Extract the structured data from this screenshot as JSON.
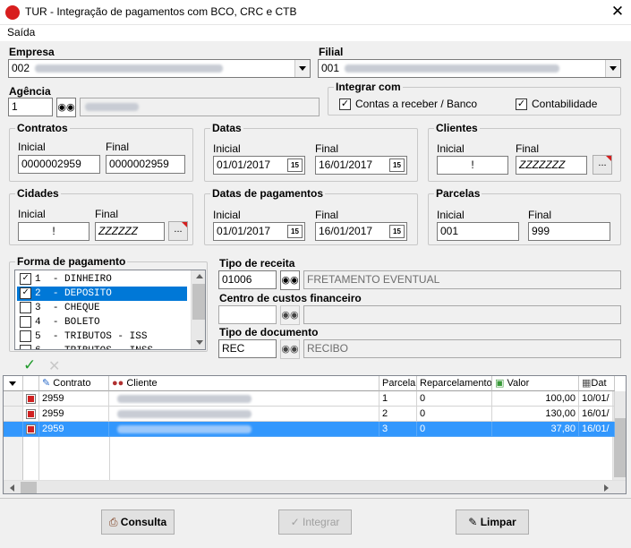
{
  "window": {
    "title": "TUR - Integração de pagamentos com BCO, CRC e CTB",
    "close_glyph": "✕"
  },
  "menu": {
    "saida": "Saída"
  },
  "empresa": {
    "label": "Empresa",
    "code": "002"
  },
  "filial": {
    "label": "Filial",
    "code": "001"
  },
  "agencia": {
    "label": "Agência",
    "value": "1"
  },
  "integrar": {
    "label": "Integrar com",
    "contas_label": "Contas a receber / Banco",
    "contas_checked": true,
    "contab_label": "Contabilidade",
    "contab_checked": true
  },
  "contratos": {
    "label": "Contratos",
    "inicial_label": "Inicial",
    "final_label": "Final",
    "inicial": "0000002959",
    "final": "0000002959"
  },
  "datas": {
    "label": "Datas",
    "inicial_label": "Inicial",
    "final_label": "Final",
    "inicial": "01/01/2017",
    "final": "16/01/2017"
  },
  "clientes": {
    "label": "Clientes",
    "inicial_label": "Inicial",
    "final_label": "Final",
    "inicial": "!",
    "final": "ZZZZZZZ"
  },
  "cidades": {
    "label": "Cidades",
    "inicial_label": "Inicial",
    "final_label": "Final",
    "inicial": "!",
    "final": "ZZZZZZ"
  },
  "datas_pag": {
    "label": "Datas de pagamentos",
    "inicial_label": "Inicial",
    "final_label": "Final",
    "inicial": "01/01/2017",
    "final": "16/01/2017"
  },
  "parcelas": {
    "label": "Parcelas",
    "inicial_label": "Inicial",
    "final_label": "Final",
    "inicial": "001",
    "final": "999"
  },
  "forma": {
    "label": "Forma de pagamento",
    "items": [
      {
        "code": "1",
        "text": "- DINHEIRO",
        "checked": true,
        "selected": false
      },
      {
        "code": "2",
        "text": "- DEPOSITO",
        "checked": true,
        "selected": true
      },
      {
        "code": "3",
        "text": "- CHEQUE",
        "checked": false,
        "selected": false
      },
      {
        "code": "4",
        "text": "- BOLETO",
        "checked": false,
        "selected": false
      },
      {
        "code": "5",
        "text": "- TRIBUTOS - ISS",
        "checked": false,
        "selected": false
      },
      {
        "code": "6",
        "text": "- TRIBUTOS - INSS",
        "checked": false,
        "selected": false
      }
    ]
  },
  "tipo_receita": {
    "label": "Tipo de receita",
    "code": "01006",
    "desc": "FRETAMENTO EVENTUAL"
  },
  "centro_custos": {
    "label": "Centro de custos financeiro",
    "code": "",
    "desc": ""
  },
  "tipo_doc": {
    "label": "Tipo de documento",
    "code": "REC",
    "desc": "RECIBO"
  },
  "cal_glyph": "15",
  "dots_glyph": "...",
  "check_glyph": "✓",
  "grid": {
    "headers": [
      "Contrato",
      "Cliente",
      "Parcela",
      "Reparcelamento",
      "Valor",
      "Dat"
    ],
    "rows": [
      {
        "contrato": "2959",
        "parcela": "1",
        "reparc": "0",
        "valor": "100,00",
        "data": "10/01/",
        "selected": false
      },
      {
        "contrato": "2959",
        "parcela": "2",
        "reparc": "0",
        "valor": "130,00",
        "data": "16/01/",
        "selected": false
      },
      {
        "contrato": "2959",
        "parcela": "3",
        "reparc": "0",
        "valor": "37,80",
        "data": "16/01/",
        "selected": true
      }
    ]
  },
  "buttons": {
    "consulta": "Consulta",
    "integrar": "Integrar",
    "limpar": "Limpar"
  }
}
